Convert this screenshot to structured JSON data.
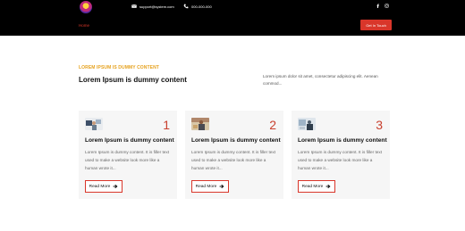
{
  "header": {
    "email": "support@system.com",
    "phone": "000-000-000",
    "nav_home": "Home",
    "cta_label": "Get In Touch"
  },
  "intro": {
    "eyebrow": "LOREM IPSUM IS DUMMY CONTENT",
    "title": "Lorem Ipsum is dummy content",
    "text": "Lorem ipsum dolor sit amet, consectetur adipiscing elit. Aenean commod..."
  },
  "cards": [
    {
      "number": "1",
      "title": "Lorem Ipsum is dummy content",
      "text": "Lorem Ipsum is dummy content. It is filler text used to make a website look more like a human wrote it...",
      "button": "Read More"
    },
    {
      "number": "2",
      "title": "Lorem Ipsum is dummy content",
      "text": "Lorem Ipsum is dummy content. It is filler text used to make a website look more like a human wrote it...",
      "button": "Read More"
    },
    {
      "number": "3",
      "title": "Lorem Ipsum is dummy content",
      "text": "Lorem Ipsum is dummy content. It is filler text used to make a website look more like a human wrote it...",
      "button": "Read More"
    }
  ],
  "colors": {
    "accent_red": "#d9362a",
    "eyebrow_gold": "#e6a21f",
    "header_bg": "#000000",
    "card_bg": "#f6f6f6"
  },
  "icons": [
    "logo-icon",
    "mail-icon",
    "phone-icon",
    "facebook-icon",
    "instagram-icon",
    "arrow-right-icon"
  ]
}
